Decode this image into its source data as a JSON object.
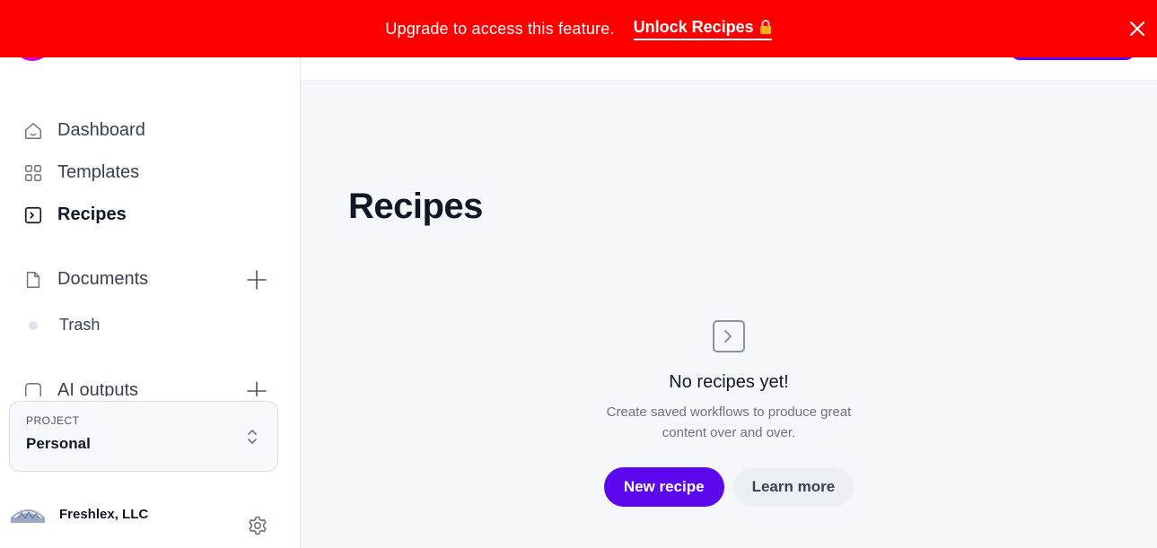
{
  "banner": {
    "message": "Upgrade to access this feature.",
    "link_label": "Unlock Recipes"
  },
  "sidebar": {
    "nav": [
      {
        "label": "Dashboard",
        "icon": "home-icon"
      },
      {
        "label": "Templates",
        "icon": "grid-icon"
      },
      {
        "label": "Recipes",
        "icon": "terminal-icon",
        "active": true
      }
    ],
    "documents_label": "Documents",
    "trash_label": "Trash",
    "ai_outputs_label": "AI outputs",
    "project": {
      "label": "PROJECT",
      "value": "Personal"
    },
    "account_name": "Freshlex, LLC"
  },
  "main": {
    "title": "Recipes",
    "empty": {
      "title": "No recipes yet!",
      "description": "Create saved workflows to produce great content over and over.",
      "primary_button": "New recipe",
      "secondary_button": "Learn more"
    }
  },
  "colors": {
    "banner": "#ff0000",
    "brand": "#5b08ee",
    "logo": "#d100d1",
    "main_bg": "#f5f7fa"
  }
}
